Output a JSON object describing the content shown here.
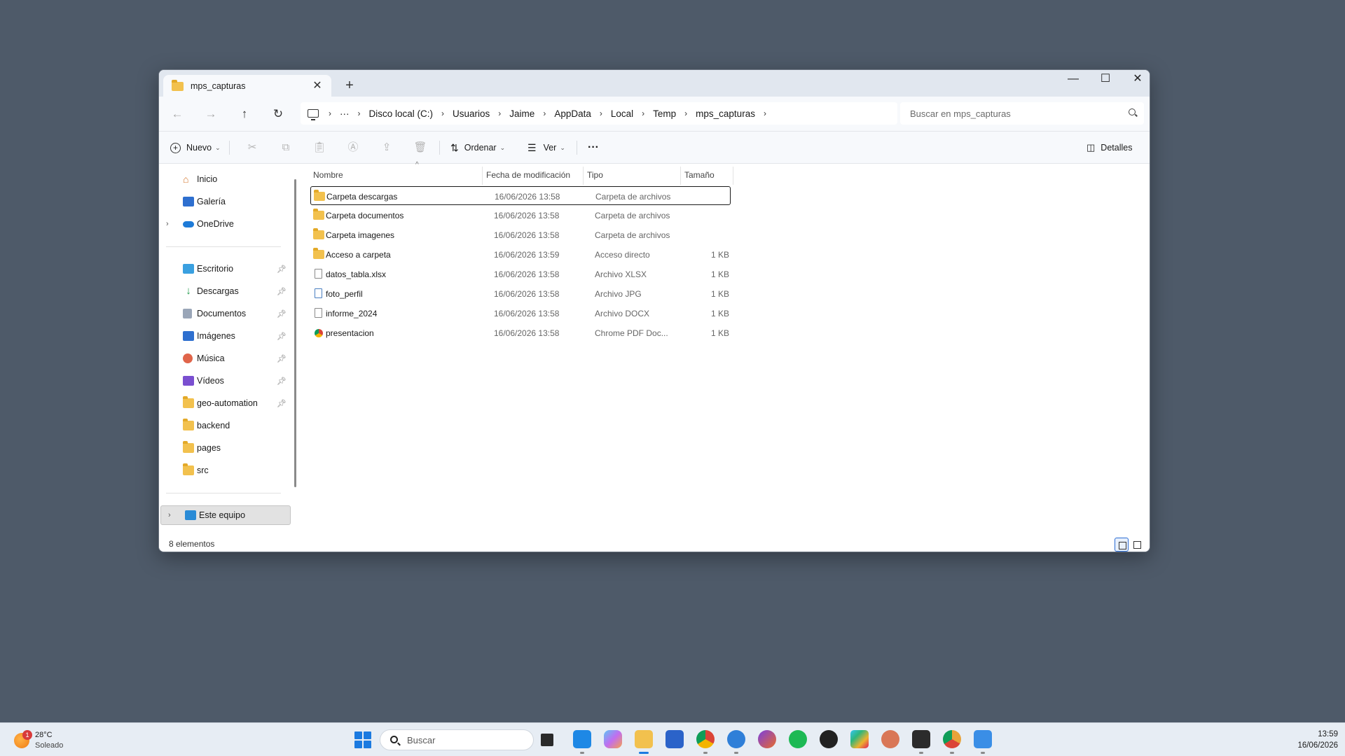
{
  "window": {
    "tab_title": "mps_capturas",
    "new_tab": "+",
    "minimize": "—",
    "maximize": "☐",
    "close": "✕",
    "tab_close": "✕"
  },
  "nav": {
    "back": "←",
    "forward": "→",
    "up": "↑",
    "refresh": "↻",
    "ellipsis": "···",
    "breadcrumb": [
      "Disco local (C:)",
      "Usuarios",
      "Jaime",
      "AppData",
      "Local",
      "Temp",
      "mps_capturas"
    ],
    "search_placeholder": "Buscar en mps_capturas"
  },
  "toolbar": {
    "new_label": "Nuevo",
    "sort_label": "Ordenar",
    "view_label": "Ver",
    "more": "···",
    "details_label": "Detalles",
    "icons": [
      "cut-icon",
      "copy-icon",
      "paste-icon",
      "rename-icon",
      "share-icon",
      "delete-icon"
    ]
  },
  "sidebar": {
    "top_items": [
      {
        "label": "Inicio",
        "icon": "home-icon"
      },
      {
        "label": "Galería",
        "icon": "gallery-icon"
      },
      {
        "label": "OneDrive",
        "icon": "onedrive-icon"
      }
    ],
    "quick_access": [
      {
        "label": "Escritorio",
        "icon": "desktop-icon",
        "pinned": true
      },
      {
        "label": "Descargas",
        "icon": "downloads-icon",
        "pinned": true
      },
      {
        "label": "Documentos",
        "icon": "documents-icon",
        "pinned": true
      },
      {
        "label": "Imágenes",
        "icon": "pictures-icon",
        "pinned": true
      },
      {
        "label": "Música",
        "icon": "music-icon",
        "pinned": true
      },
      {
        "label": "Vídeos",
        "icon": "videos-icon",
        "pinned": true
      },
      {
        "label": "geo-automation",
        "icon": "folder-icon",
        "pinned": true
      },
      {
        "label": "backend",
        "icon": "folder-icon",
        "pinned": false
      },
      {
        "label": "pages",
        "icon": "folder-icon",
        "pinned": false
      },
      {
        "label": "src",
        "icon": "folder-icon",
        "pinned": false
      }
    ],
    "this_pc": "Este equipo"
  },
  "columns": {
    "name": "Nombre",
    "date": "Fecha de modificación",
    "type": "Tipo",
    "size": "Tamaño"
  },
  "files": [
    {
      "name": "Carpeta descargas",
      "date": "16/06/2026 13:58",
      "type": "Carpeta de archivos",
      "size": "",
      "icon": "folder-icon"
    },
    {
      "name": "Carpeta documentos",
      "date": "16/06/2026 13:58",
      "type": "Carpeta de archivos",
      "size": "",
      "icon": "folder-icon"
    },
    {
      "name": "Carpeta imagenes",
      "date": "16/06/2026 13:58",
      "type": "Carpeta de archivos",
      "size": "",
      "icon": "folder-icon"
    },
    {
      "name": "Acceso a carpeta",
      "date": "16/06/2026 13:59",
      "type": "Acceso directo",
      "size": "1 KB",
      "icon": "shortcut-folder-icon"
    },
    {
      "name": "datos_tabla.xlsx",
      "date": "16/06/2026 13:58",
      "type": "Archivo XLSX",
      "size": "1 KB",
      "icon": "file-icon"
    },
    {
      "name": "foto_perfil",
      "date": "16/06/2026 13:58",
      "type": "Archivo JPG",
      "size": "1 KB",
      "icon": "image-file-icon"
    },
    {
      "name": "informe_2024",
      "date": "16/06/2026 13:58",
      "type": "Archivo DOCX",
      "size": "1 KB",
      "icon": "file-icon"
    },
    {
      "name": "presentacion",
      "date": "16/06/2026 13:58",
      "type": "Chrome PDF Doc...",
      "size": "1 KB",
      "icon": "chrome-pdf-icon"
    }
  ],
  "status": {
    "count": "8 elementos"
  },
  "taskbar": {
    "weather_temp": "28°C",
    "weather_cond": "Soleado",
    "weather_badge": "1",
    "search_placeholder": "Buscar",
    "time": "13:59",
    "date": "16/06/2026",
    "apps": [
      "task-view-icon",
      "vscode-icon",
      "copilot-icon",
      "file-explorer-icon",
      "store-icon",
      "chrome-icon",
      "thunderbird-icon",
      "firefox-dev-icon",
      "spotify-icon",
      "inkscape-icon",
      "slack-icon",
      "claude-icon",
      "terminal-icon",
      "chrome-canary-icon",
      "photos-icon"
    ]
  }
}
